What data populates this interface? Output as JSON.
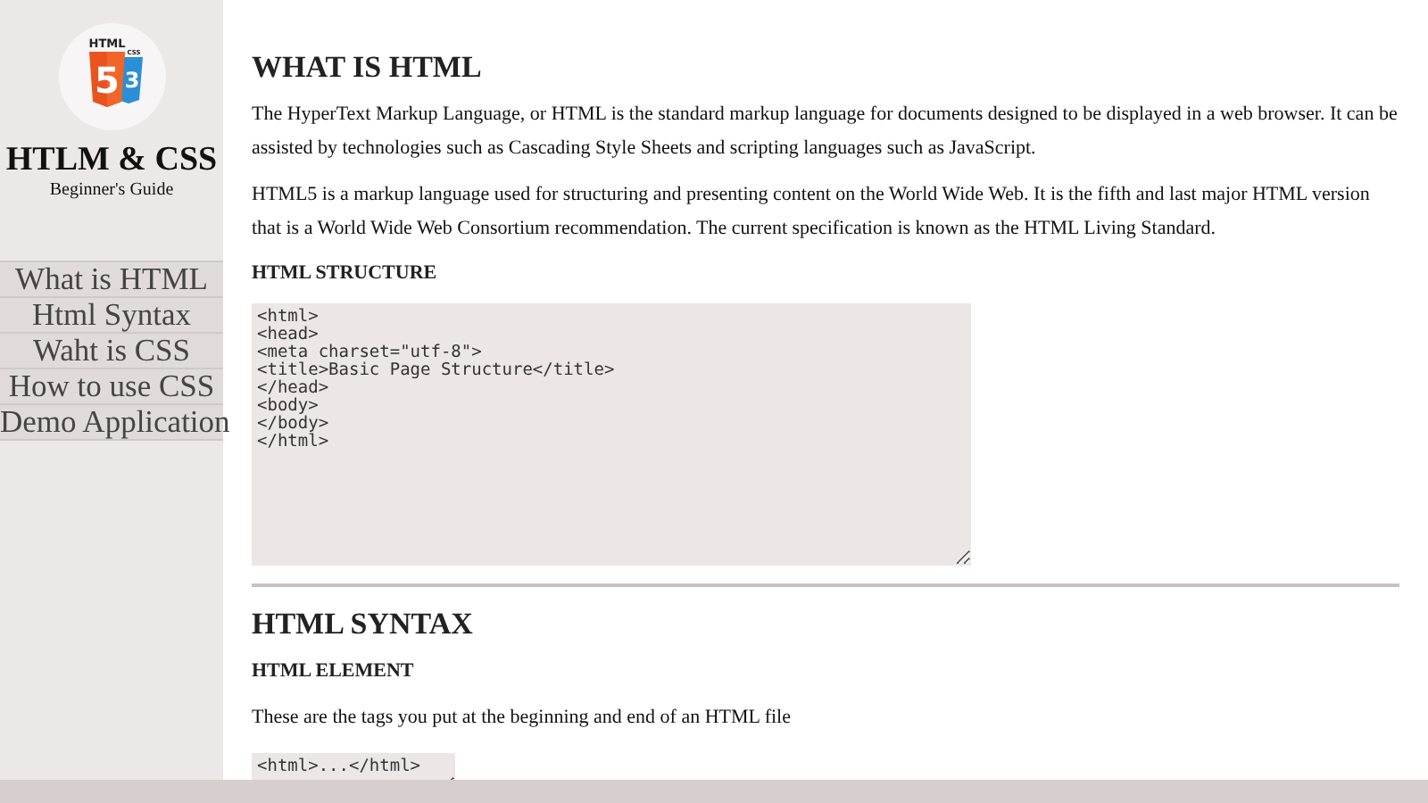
{
  "sidebar": {
    "logo": {
      "html_label": "HTML",
      "html_digit": "5",
      "css_label": "CSS",
      "css_digit": "3"
    },
    "title": "HTLM & CSS",
    "subtitle": "Beginner's Guide",
    "nav": [
      "What is HTML",
      "Html Syntax",
      "Waht is CSS",
      "How to use CSS",
      "Demo Application"
    ]
  },
  "sections": [
    {
      "heading": "WHAT IS HTML",
      "blocks": [
        {
          "kind": "paragraph",
          "text": "The HyperText Markup Language, or HTML is the standard markup language for documents designed to be displayed in a web browser. It can be assisted by technologies such as Cascading Style Sheets and scripting languages such as JavaScript."
        },
        {
          "kind": "paragraph",
          "text": "HTML5 is a markup language used for structuring and presenting content on the World Wide Web. It is the fifth and last major HTML version that is a World Wide Web Consortium recommendation. The current specification is known as the HTML Living Standard."
        },
        {
          "kind": "subheading",
          "text": "HTML STRUCTURE"
        },
        {
          "kind": "code_block",
          "text": "<html>\n<head>\n<meta charset=\"utf-8\">\n<title>Basic Page Structure</title>\n</head>\n<body>\n</body>\n</html>"
        }
      ]
    },
    {
      "heading": "HTML SYNTAX",
      "blocks": [
        {
          "kind": "subheading",
          "text": "HTML ELEMENT"
        },
        {
          "kind": "paragraph",
          "text": "These are the tags you put at the beginning and end of an HTML file"
        },
        {
          "kind": "code_snippet",
          "text": "<html>...</html>"
        }
      ]
    }
  ]
}
